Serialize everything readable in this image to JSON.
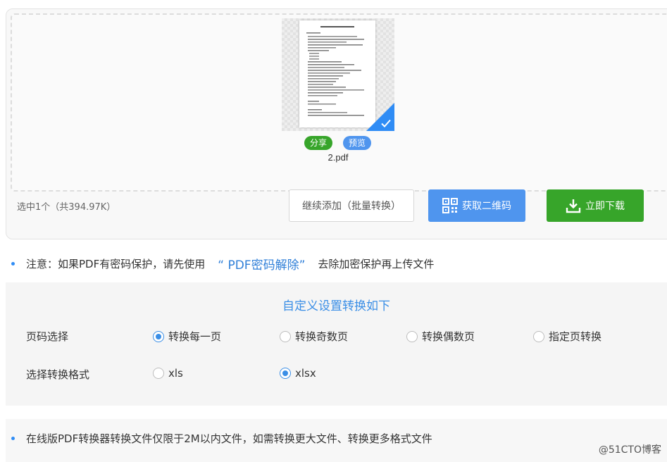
{
  "upload": {
    "file": {
      "name": "2.pdf",
      "share_label": "分享",
      "preview_label": "预览",
      "selected": true
    },
    "selected_info": "选中1个（共394.97K）",
    "continue_button": "继续添加（批量转换）",
    "qr_button": "获取二维码",
    "download_button": "立即下载"
  },
  "notice": {
    "prefix": "注意：如果PDF有密码保护，请先使用",
    "link": "“ PDF密码解除”",
    "suffix": "去除加密保护再上传文件"
  },
  "settings": {
    "title": "自定义设置转换如下",
    "page_label": "页码选择",
    "page_options": [
      {
        "label": "转换每一页",
        "checked": true
      },
      {
        "label": "转换奇数页",
        "checked": false
      },
      {
        "label": "转换偶数页",
        "checked": false
      },
      {
        "label": "指定页转换",
        "checked": false
      }
    ],
    "format_label": "选择转换格式",
    "format_options": [
      {
        "label": "xls",
        "checked": false
      },
      {
        "label": "xlsx",
        "checked": true
      }
    ]
  },
  "footer": {
    "note": "在线版PDF转换器转换文件仅限于2M以内文件，如需转换更大文件、转换更多格式文件"
  },
  "watermark": "@51CTO博客",
  "colors": {
    "primary_blue": "#4f95ee",
    "green": "#37a52a",
    "link_blue": "#2f7fd8"
  }
}
